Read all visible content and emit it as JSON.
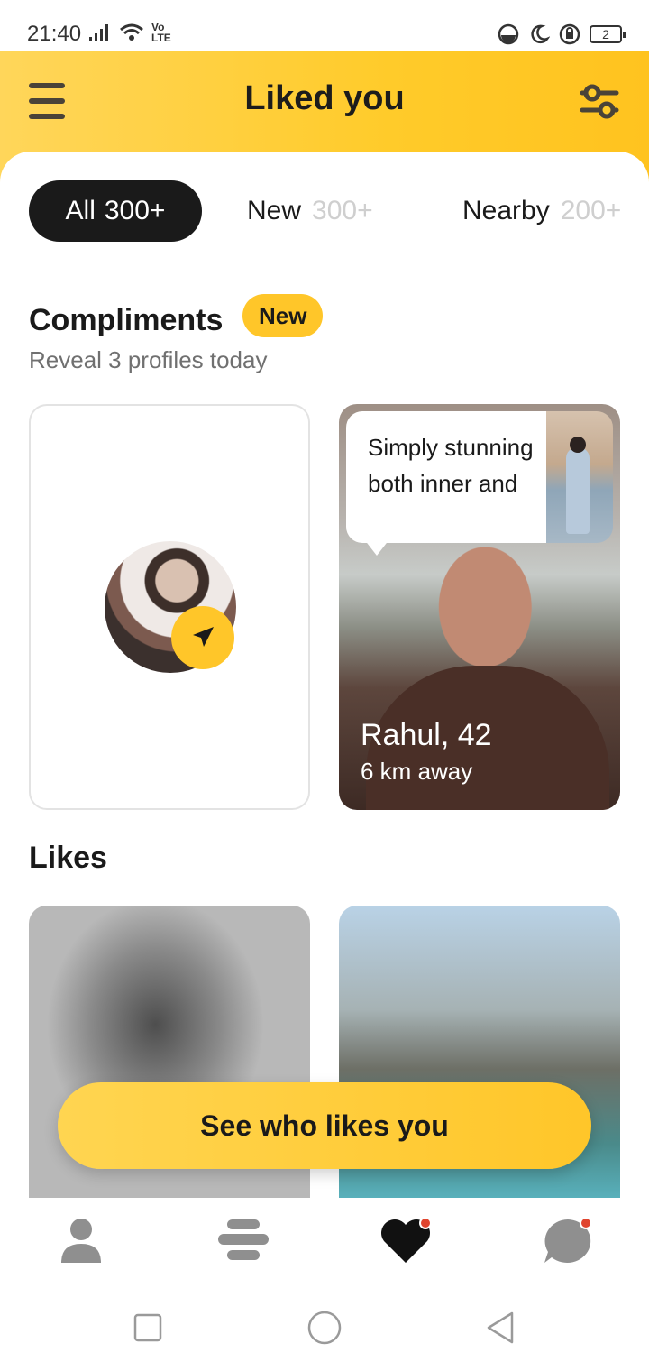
{
  "status_bar": {
    "time": "21:40",
    "network_label": "Vo LTE",
    "battery_level": "2"
  },
  "header": {
    "title": "Liked you",
    "menu_icon": "menu-icon",
    "filter_icon": "filter-icon"
  },
  "tabs": [
    {
      "label": "All",
      "count": "300+",
      "selected": true
    },
    {
      "label": "New",
      "count": "300+",
      "selected": false
    },
    {
      "label": "Nearby",
      "count": "200+",
      "selected": false
    }
  ],
  "compliments": {
    "title": "Compliments",
    "badge": "New",
    "subtitle": "Reveal 3 profiles today",
    "cards": [
      {
        "type": "send-compliment",
        "icon": "send-icon"
      },
      {
        "type": "profile",
        "bubble_text": "Simply stunning both inner and",
        "name_age": "Rahul, 42",
        "distance": "6 km away"
      }
    ]
  },
  "likes": {
    "title": "Likes"
  },
  "cta": {
    "label": "See who likes you"
  },
  "bottom_nav": [
    {
      "name": "profile",
      "icon": "person-icon"
    },
    {
      "name": "discover",
      "icon": "stack-icon"
    },
    {
      "name": "liked-you",
      "icon": "heart-icon",
      "active": true
    },
    {
      "name": "chats",
      "icon": "chat-icon"
    }
  ],
  "colors": {
    "accent": "#ffc629",
    "text_dark": "#1a1a1a",
    "notification_dot": "#e0442e"
  }
}
